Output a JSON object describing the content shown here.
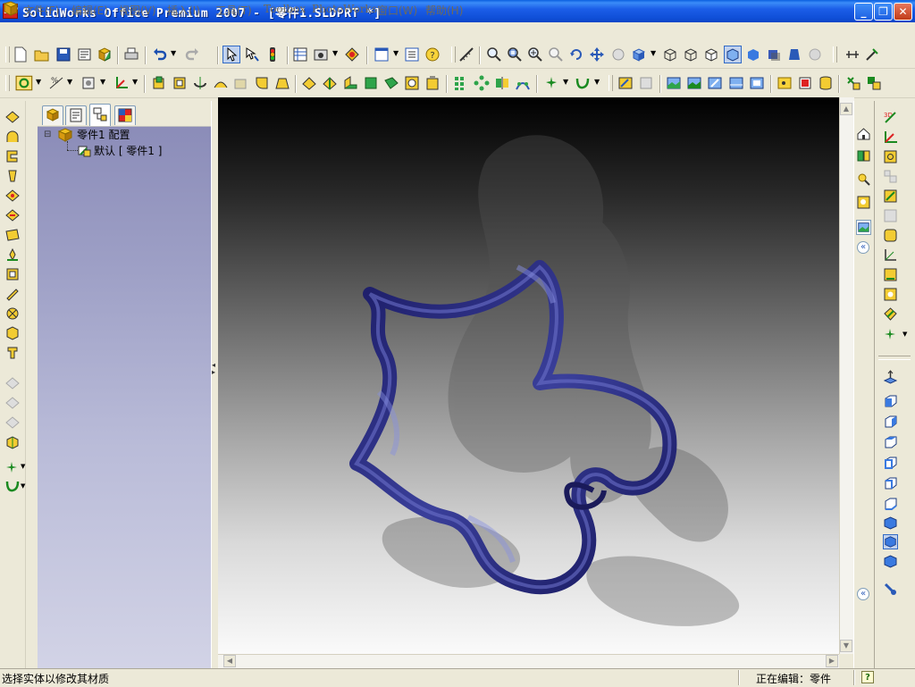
{
  "window": {
    "title": "SolidWorks Office Premium 2007 - [零件1.SLDPRT *]",
    "app_logo_text": "SW",
    "minimize_glyph": "_",
    "restore_glyph": "❐",
    "close_glyph": "✕"
  },
  "menu": {
    "items": [
      {
        "label": "文件(F)"
      },
      {
        "label": "编辑(E)"
      },
      {
        "label": "视图(V)"
      },
      {
        "label": "插入(I)"
      },
      {
        "label": "工具(T)"
      },
      {
        "label": "Toolbox"
      },
      {
        "label": "PhotoWorks"
      },
      {
        "label": "窗口(W)"
      },
      {
        "label": "帮助(H)"
      }
    ]
  },
  "feature_manager": {
    "tabs": [
      "feature-manager-icon",
      "property-manager-icon",
      "configuration-manager-icon",
      "appearance-manager-icon"
    ],
    "active_tab": 2,
    "tree": {
      "root_label": "零件1 配置",
      "collapse_glyph": "⊟",
      "child_label": "默认 [ 零件1 ]"
    }
  },
  "viewport": {
    "model": "twisted-ribbon-ring",
    "colors": {
      "model": "#23237a",
      "model_highlight": "#6a6fc8",
      "shadow": "#7a7a7a"
    }
  },
  "statusbar": {
    "message": "选择实体以修改其材质",
    "editing": "正在编辑：零件",
    "help_glyph": "?"
  },
  "colors": {
    "titlebar": "#0c4fd8",
    "chrome": "#ece9d8",
    "panel_gradient_top": "#8889b6",
    "panel_gradient_bottom": "#d2d3e6"
  }
}
